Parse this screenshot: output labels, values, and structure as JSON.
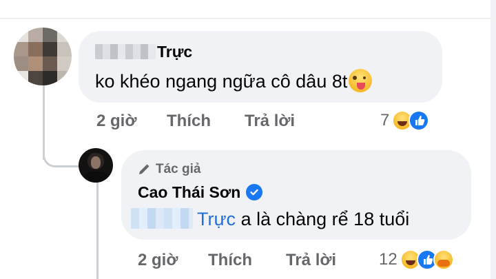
{
  "comment1": {
    "author_suffix": "Trực",
    "text": "ko khéo ngang ngữa cô dâu 8t",
    "time": "2 giờ",
    "like_label": "Thích",
    "reply_label": "Trả lời",
    "reaction_count": "7",
    "reactions": [
      "haha-icon",
      "like-icon"
    ]
  },
  "reply1": {
    "badge": "Tác giả",
    "author": "Cao Thái Sơn",
    "mention_suffix": "Trực",
    "text": " a là chàng rể 18 tuổi",
    "time": "2 giờ",
    "like_label": "Thích",
    "reply_label": "Trả lời",
    "reaction_count": "12",
    "reactions": [
      "haha-icon",
      "like-icon",
      "care-icon"
    ]
  },
  "colors": {
    "bubble": "#f0f2f5",
    "secondary_text": "#65676b",
    "mention": "#216fdb",
    "verified": "#1877f2"
  }
}
